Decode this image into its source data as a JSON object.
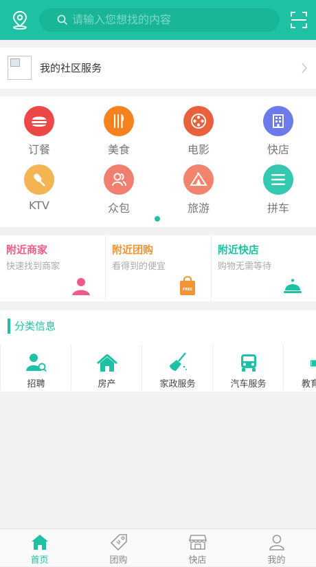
{
  "header": {
    "search_placeholder": "请输入您想找的内容",
    "location_icon": "location-pin-icon",
    "scan_icon": "scan-icon",
    "color": "#1ec1a4"
  },
  "community": {
    "label": "我的社区服务"
  },
  "categories": [
    {
      "label": "订餐",
      "icon": "burger-icon",
      "color": "#ec4848"
    },
    {
      "label": "美食",
      "icon": "cutlery-icon",
      "color": "#f5821f"
    },
    {
      "label": "电影",
      "icon": "film-reel-icon",
      "color": "#e8603c"
    },
    {
      "label": "快店",
      "icon": "building-icon",
      "color": "#6d7ae9"
    },
    {
      "label": "KTV",
      "icon": "microphone-icon",
      "color": "#f5b454"
    },
    {
      "label": "众包",
      "icon": "users-icon",
      "color": "#f07f6f"
    },
    {
      "label": "旅游",
      "icon": "tent-icon",
      "color": "#f2836c"
    },
    {
      "label": "拼车",
      "icon": "menu-lines-icon",
      "color": "#35c8b0"
    }
  ],
  "nearby": [
    {
      "title": "附近商家",
      "subtitle": "快速找到商家",
      "color": "#ed5c86"
    },
    {
      "title": "附近团购",
      "subtitle": "看得到的便宜",
      "color": "#f19433",
      "badge": "FREE"
    },
    {
      "title": "附近快店",
      "subtitle": "购物无需等待",
      "color": "#1ec1a4"
    }
  ],
  "classify": {
    "title": "分类信息",
    "items": [
      {
        "label": "招聘",
        "icon": "recruit-icon"
      },
      {
        "label": "房产",
        "icon": "house-icon"
      },
      {
        "label": "家政服务",
        "icon": "broom-icon"
      },
      {
        "label": "汽车服务",
        "icon": "car-icon"
      },
      {
        "label": "教育",
        "icon": "book-icon"
      }
    ]
  },
  "tabs": [
    {
      "label": "首页",
      "icon": "home-icon",
      "active": true
    },
    {
      "label": "团购",
      "icon": "tag-icon",
      "active": false
    },
    {
      "label": "快店",
      "icon": "shop-icon",
      "active": false
    },
    {
      "label": "我的",
      "icon": "user-icon",
      "active": false
    }
  ]
}
